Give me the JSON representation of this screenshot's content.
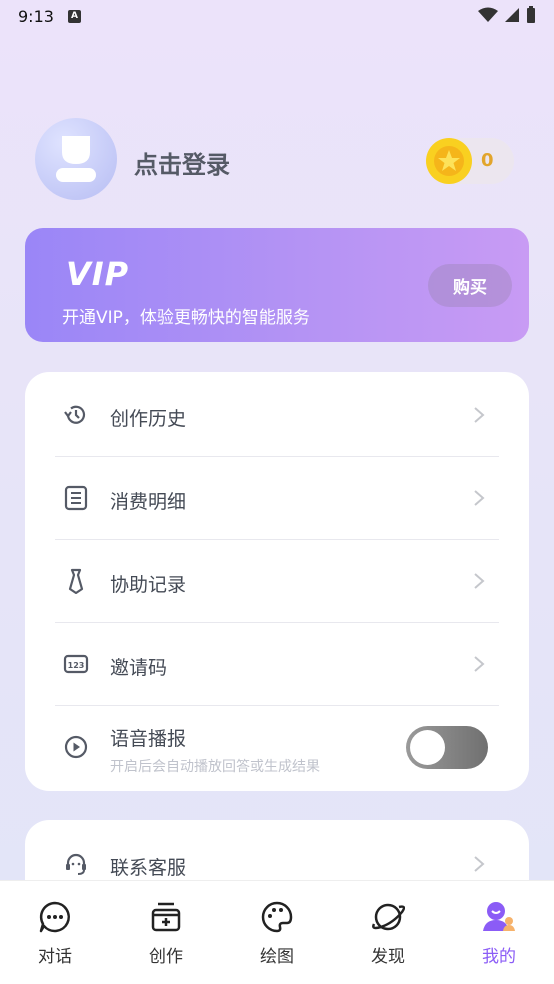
{
  "status_bar": {
    "time": "9:13",
    "notification_glyph": "A"
  },
  "profile": {
    "login_label": "点击登录",
    "coins": "0"
  },
  "vip": {
    "title": "VIP",
    "description": "开通VIP，体验更畅快的智能服务",
    "buy_label": "购买"
  },
  "menu": {
    "items": [
      {
        "label": "创作历史",
        "icon": "history-icon"
      },
      {
        "label": "消费明细",
        "icon": "receipt-list-icon"
      },
      {
        "label": "协助记录",
        "icon": "tie-icon"
      },
      {
        "label": "邀请码",
        "icon": "code-123-icon"
      }
    ],
    "voice": {
      "label": "语音播报",
      "subtitle": "开启后会自动播放回答或生成结果",
      "enabled": false
    }
  },
  "support": {
    "label": "联系客服",
    "icon": "headset-icon"
  },
  "tabs": [
    {
      "label": "对话",
      "icon": "chat-icon"
    },
    {
      "label": "创作",
      "icon": "create-icon"
    },
    {
      "label": "绘图",
      "icon": "palette-icon"
    },
    {
      "label": "发现",
      "icon": "planet-icon"
    },
    {
      "label": "我的",
      "icon": "profile-icon",
      "active": true
    }
  ],
  "colors": {
    "accent": "#8b5cf6",
    "coin": "#f9d020",
    "coin_text": "#e2a52b",
    "vip_start": "#9a86f7",
    "vip_end": "#c89bf4"
  }
}
